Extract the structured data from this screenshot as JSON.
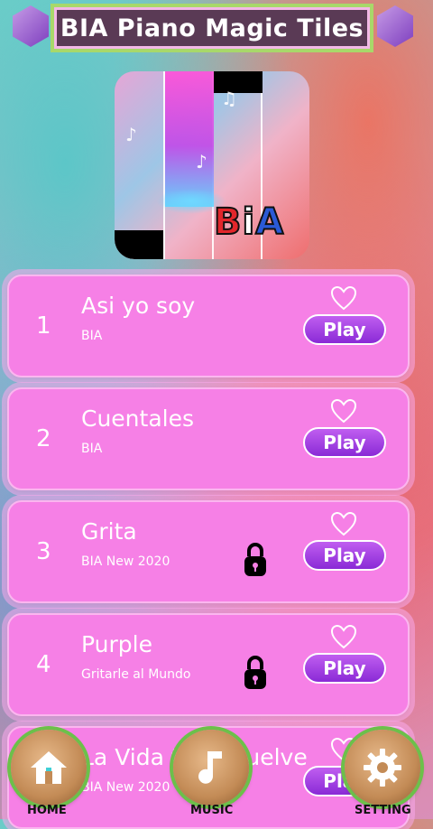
{
  "header": {
    "title": "BIA Piano Magic Tiles"
  },
  "album": {
    "logo_text": {
      "b": "B",
      "i": "i",
      "a": "A"
    }
  },
  "songs": [
    {
      "number": "1",
      "title": "Asi yo soy",
      "artist": "BIA",
      "play_label": "Play",
      "locked": false
    },
    {
      "number": "2",
      "title": "Cuentales",
      "artist": "BIA",
      "play_label": "Play",
      "locked": false
    },
    {
      "number": "3",
      "title": "Grita",
      "artist": "BIA New 2020",
      "play_label": "Play",
      "locked": true
    },
    {
      "number": "4",
      "title": "Purple",
      "artist": "Gritarle al Mundo",
      "play_label": "Play",
      "locked": true
    },
    {
      "number": "",
      "title": "La Vida te Devuelve",
      "artist": "BIA New 2020",
      "play_label": "Play",
      "locked": false
    }
  ],
  "nav": {
    "home": "HOME",
    "music": "MUSIC",
    "setting": "SETTING"
  },
  "colors": {
    "card": "#f680e6",
    "play": "#9a3ae0",
    "title_bg": "#5a3a55",
    "title_border": "#a8d86a"
  }
}
